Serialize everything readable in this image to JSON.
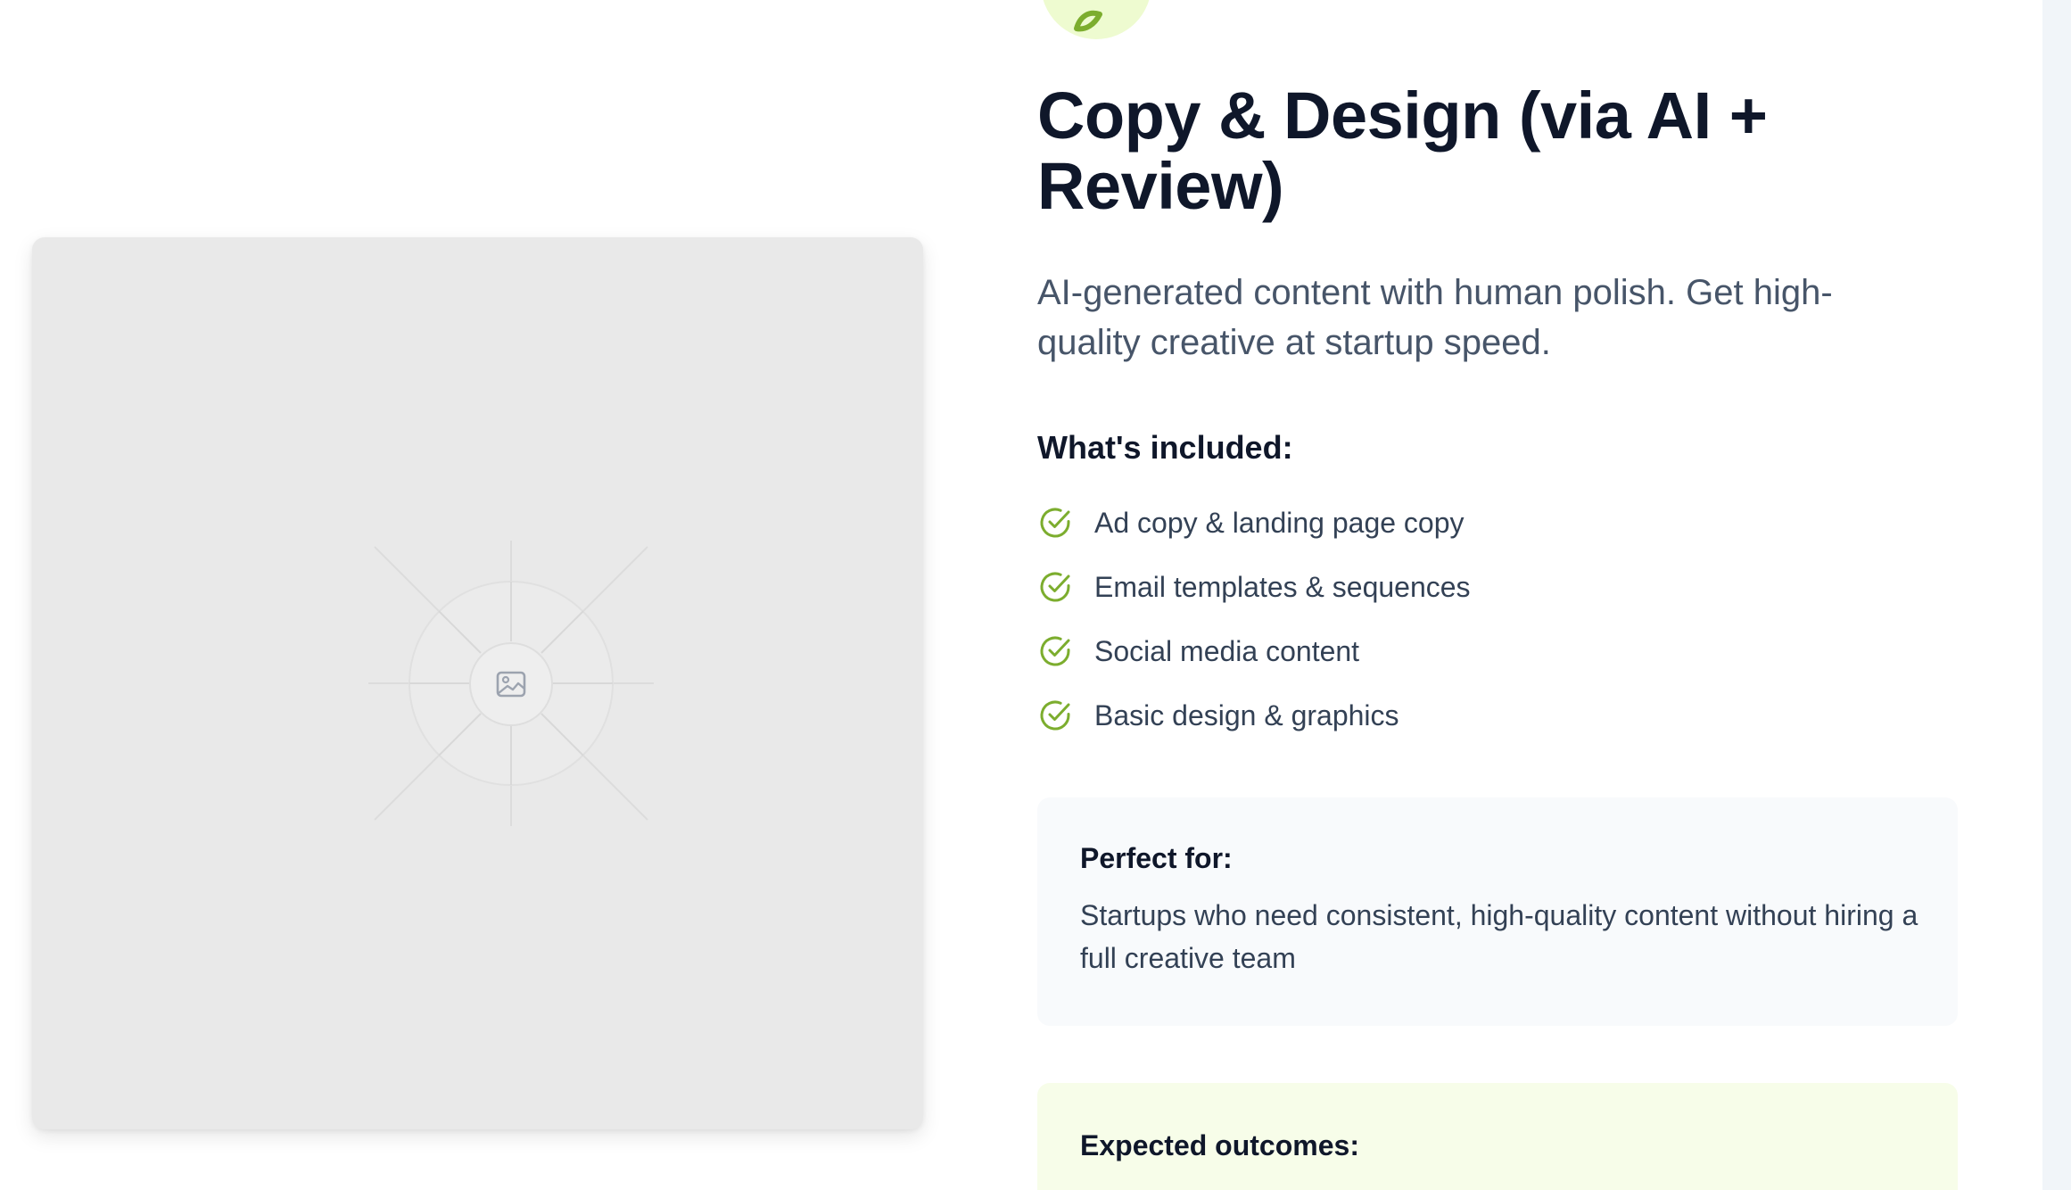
{
  "service": {
    "icon": "leaf-icon",
    "title": "Copy & Design (via AI + Review)",
    "subtitle": "AI-generated content with human polish. Get high-quality creative at startup speed."
  },
  "image": {
    "icon": "image-placeholder-icon"
  },
  "included": {
    "heading": "What's included:",
    "items": [
      {
        "label": "Ad copy & landing page copy",
        "icon": "check-circle-icon"
      },
      {
        "label": "Email templates & sequences",
        "icon": "check-circle-icon"
      },
      {
        "label": "Social media content",
        "icon": "check-circle-icon"
      },
      {
        "label": "Basic design & graphics",
        "icon": "check-circle-icon"
      }
    ]
  },
  "perfect_for": {
    "heading": "Perfect for:",
    "text": "Startups who need consistent, high-quality content without hiring a full creative team"
  },
  "outcomes": {
    "heading": "Expected outcomes:"
  },
  "colors": {
    "accent_green": "#7cad2e",
    "icon_bg": "#eefbd0",
    "title": "#0f172a",
    "body": "#475569",
    "perfect_bg": "#f8fafc",
    "outcomes_bg": "#f7fde9",
    "placeholder_bg": "#e9e9e9"
  }
}
